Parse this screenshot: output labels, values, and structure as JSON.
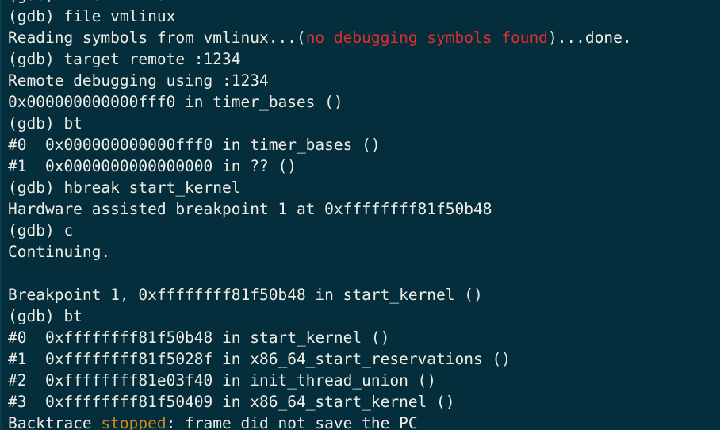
{
  "terminal": {
    "app": "gdb-console",
    "colors": {
      "background": "#042e3b",
      "foreground": "#eeeee6",
      "red": "#dd2e2e",
      "orange": "#d08a1a",
      "left_edge": "#0b3c4b"
    },
    "prompt": "(gdb)",
    "lines": [
      {
        "id": "line-0-clipped",
        "clipped": true,
        "segments": [
          {
            "text": "(gdb) file vmlinux",
            "color": "default"
          }
        ]
      },
      {
        "id": "line-1",
        "segments": [
          {
            "text": "(gdb) file vmlinux",
            "color": "default"
          }
        ]
      },
      {
        "id": "line-2",
        "segments": [
          {
            "text": "Reading symbols from vmlinux...(",
            "color": "default"
          },
          {
            "text": "no debugging symbols found",
            "color": "red"
          },
          {
            "text": ")...done.",
            "color": "default"
          }
        ]
      },
      {
        "id": "line-3",
        "segments": [
          {
            "text": "(gdb) target remote :1234",
            "color": "default"
          }
        ]
      },
      {
        "id": "line-4",
        "segments": [
          {
            "text": "Remote debugging using :1234",
            "color": "default"
          }
        ]
      },
      {
        "id": "line-5",
        "segments": [
          {
            "text": "0x000000000000fff0 in timer_bases ()",
            "color": "default"
          }
        ]
      },
      {
        "id": "line-6",
        "segments": [
          {
            "text": "(gdb) bt",
            "color": "default"
          }
        ]
      },
      {
        "id": "line-7",
        "segments": [
          {
            "text": "#0  0x000000000000fff0 in timer_bases ()",
            "color": "default"
          }
        ]
      },
      {
        "id": "line-8",
        "segments": [
          {
            "text": "#1  0x0000000000000000 in ?? ()",
            "color": "default"
          }
        ]
      },
      {
        "id": "line-9",
        "segments": [
          {
            "text": "(gdb) hbreak start_kernel",
            "color": "default"
          }
        ]
      },
      {
        "id": "line-10",
        "segments": [
          {
            "text": "Hardware assisted breakpoint 1 at 0xffffffff81f50b48",
            "color": "default"
          }
        ]
      },
      {
        "id": "line-11",
        "segments": [
          {
            "text": "(gdb) c",
            "color": "default"
          }
        ]
      },
      {
        "id": "line-12",
        "segments": [
          {
            "text": "Continuing.",
            "color": "default"
          }
        ]
      },
      {
        "id": "line-13-blank",
        "blank": true,
        "segments": [
          {
            "text": "",
            "color": "default"
          }
        ]
      },
      {
        "id": "line-14",
        "segments": [
          {
            "text": "Breakpoint 1, 0xffffffff81f50b48 in start_kernel ()",
            "color": "default"
          }
        ]
      },
      {
        "id": "line-15",
        "segments": [
          {
            "text": "(gdb) bt",
            "color": "default"
          }
        ]
      },
      {
        "id": "line-16",
        "segments": [
          {
            "text": "#0  0xffffffff81f50b48 in start_kernel ()",
            "color": "default"
          }
        ]
      },
      {
        "id": "line-17",
        "segments": [
          {
            "text": "#1  0xffffffff81f5028f in x86_64_start_reservations ()",
            "color": "default"
          }
        ]
      },
      {
        "id": "line-18",
        "segments": [
          {
            "text": "#2  0xffffffff81e03f40 in init_thread_union ()",
            "color": "default"
          }
        ]
      },
      {
        "id": "line-19",
        "segments": [
          {
            "text": "#3  0xffffffff81f50409 in x86_64_start_kernel ()",
            "color": "default"
          }
        ]
      },
      {
        "id": "line-20",
        "segments": [
          {
            "text": "Backtrace ",
            "color": "default"
          },
          {
            "text": "stopped",
            "color": "orange"
          },
          {
            "text": ": frame did not save the PC",
            "color": "default"
          }
        ]
      }
    ]
  }
}
